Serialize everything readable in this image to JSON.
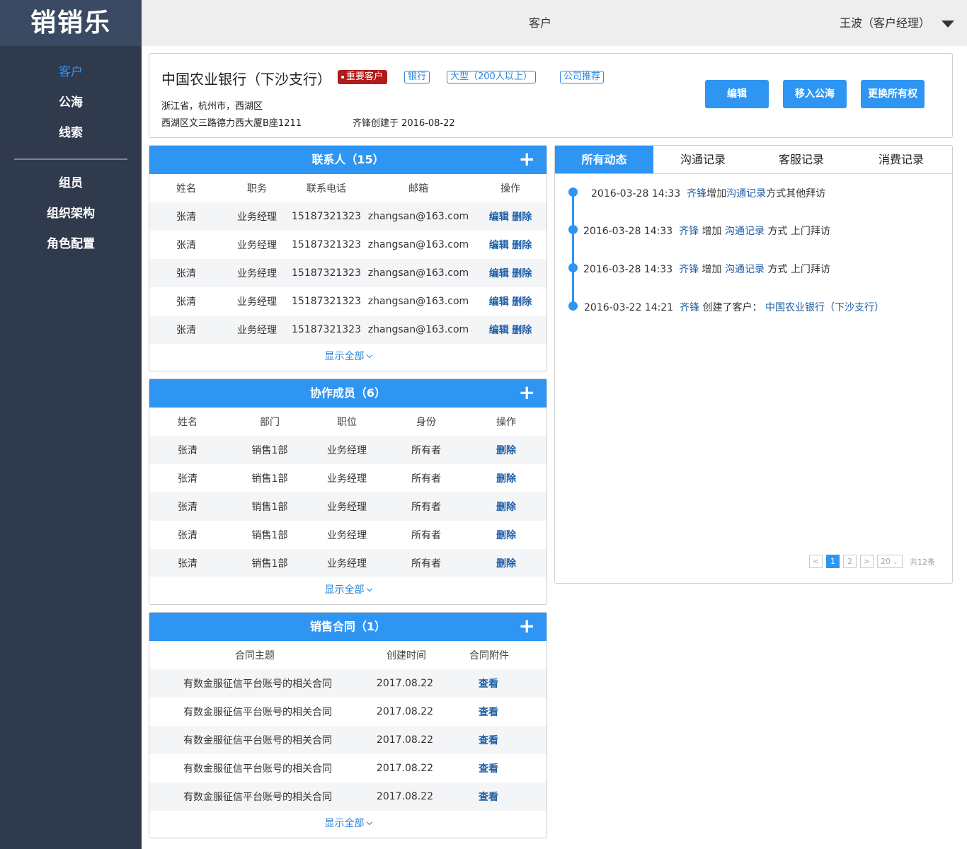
{
  "app": {
    "logo": "销销乐"
  },
  "nav": {
    "group1": [
      "客户",
      "公海",
      "线索"
    ],
    "group2": [
      "组员",
      "组织架构",
      "角色配置"
    ]
  },
  "header": {
    "title": "客户",
    "user": "王波（客户经理）"
  },
  "customer": {
    "name": "中国农业银行（下沙支行）",
    "important_tag": "重要客户",
    "tags": [
      "银行",
      "大型（200人以上）",
      "公司推荐"
    ],
    "region": "浙江省，杭州市，西湖区",
    "address": "西湖区文三路德力西大厦B座1211",
    "created": "齐锋创建于 2016-08-22",
    "buttons": {
      "edit": "编辑",
      "move": "移入公海",
      "transfer": "更换所有权"
    }
  },
  "contacts": {
    "title": "联系人（15）",
    "columns": [
      "姓名",
      "职务",
      "联系电话",
      "邮箱",
      "操作"
    ],
    "rows": [
      [
        "张清",
        "业务经理",
        "15187321323",
        "zhangsan@163.com"
      ],
      [
        "张清",
        "业务经理",
        "15187321323",
        "zhangsan@163.com"
      ],
      [
        "张清",
        "业务经理",
        "15187321323",
        "zhangsan@163.com"
      ],
      [
        "张清",
        "业务经理",
        "15187321323",
        "zhangsan@163.com"
      ],
      [
        "张清",
        "业务经理",
        "15187321323",
        "zhangsan@163.com"
      ]
    ],
    "edit": "编辑",
    "delete": "删除",
    "show_all": "显示全部"
  },
  "members": {
    "title": "协作成员（6）",
    "columns": [
      "姓名",
      "部门",
      "职位",
      "身份",
      "操作"
    ],
    "rows": [
      [
        "张清",
        "销售1部",
        "业务经理",
        "所有者"
      ],
      [
        "张清",
        "销售1部",
        "业务经理",
        "所有者"
      ],
      [
        "张清",
        "销售1部",
        "业务经理",
        "所有者"
      ],
      [
        "张清",
        "销售1部",
        "业务经理",
        "所有者"
      ],
      [
        "张清",
        "销售1部",
        "业务经理",
        "所有者"
      ]
    ],
    "delete": "删除",
    "show_all": "显示全部"
  },
  "contracts": {
    "title": "销售合同（1）",
    "columns": [
      "合同主题",
      "创建时间",
      "合同附件"
    ],
    "rows": [
      [
        "有数金服征信平台账号的相关合同",
        "2017.08.22"
      ],
      [
        "有数金服征信平台账号的相关合同",
        "2017.08.22"
      ],
      [
        "有数金服征信平台账号的相关合同",
        "2017.08.22"
      ],
      [
        "有数金服征信平台账号的相关合同",
        "2017.08.22"
      ],
      [
        "有数金服征信平台账号的相关合同",
        "2017.08.22"
      ]
    ],
    "view": "查看",
    "show_all": "显示全部"
  },
  "activity": {
    "tabs": [
      "所有动态",
      "沟通记录",
      "客服记录",
      "消费记录"
    ],
    "events": [
      {
        "time": "2016-03-28 14:33",
        "user": "齐锋",
        "parts": [
          "增加",
          "沟通记录",
          "方式其他拜访"
        ]
      },
      {
        "time": "2016-03-28 14:33",
        "user": "齐锋",
        "parts": [
          "增加",
          "沟通记录",
          "方式 上门拜访"
        ]
      },
      {
        "time": "2016-03-28 14:33",
        "user": "齐锋",
        "parts": [
          "增加",
          "沟通记录",
          "方式 上门拜访"
        ]
      },
      {
        "time": "2016-03-22 14:21",
        "user": "齐锋",
        "parts": [
          "创建了客户：",
          "中国农业银行（下沙支行）",
          ""
        ]
      }
    ],
    "pager": {
      "prev": "<",
      "pages": [
        "1",
        "2"
      ],
      "next": ">",
      "size": "20",
      "total": "共12条"
    }
  },
  "colors": {
    "accent": "#2f95f3",
    "sidebar": "#303a4d",
    "important": "#b01b1b",
    "link": "#1d5fa5"
  }
}
